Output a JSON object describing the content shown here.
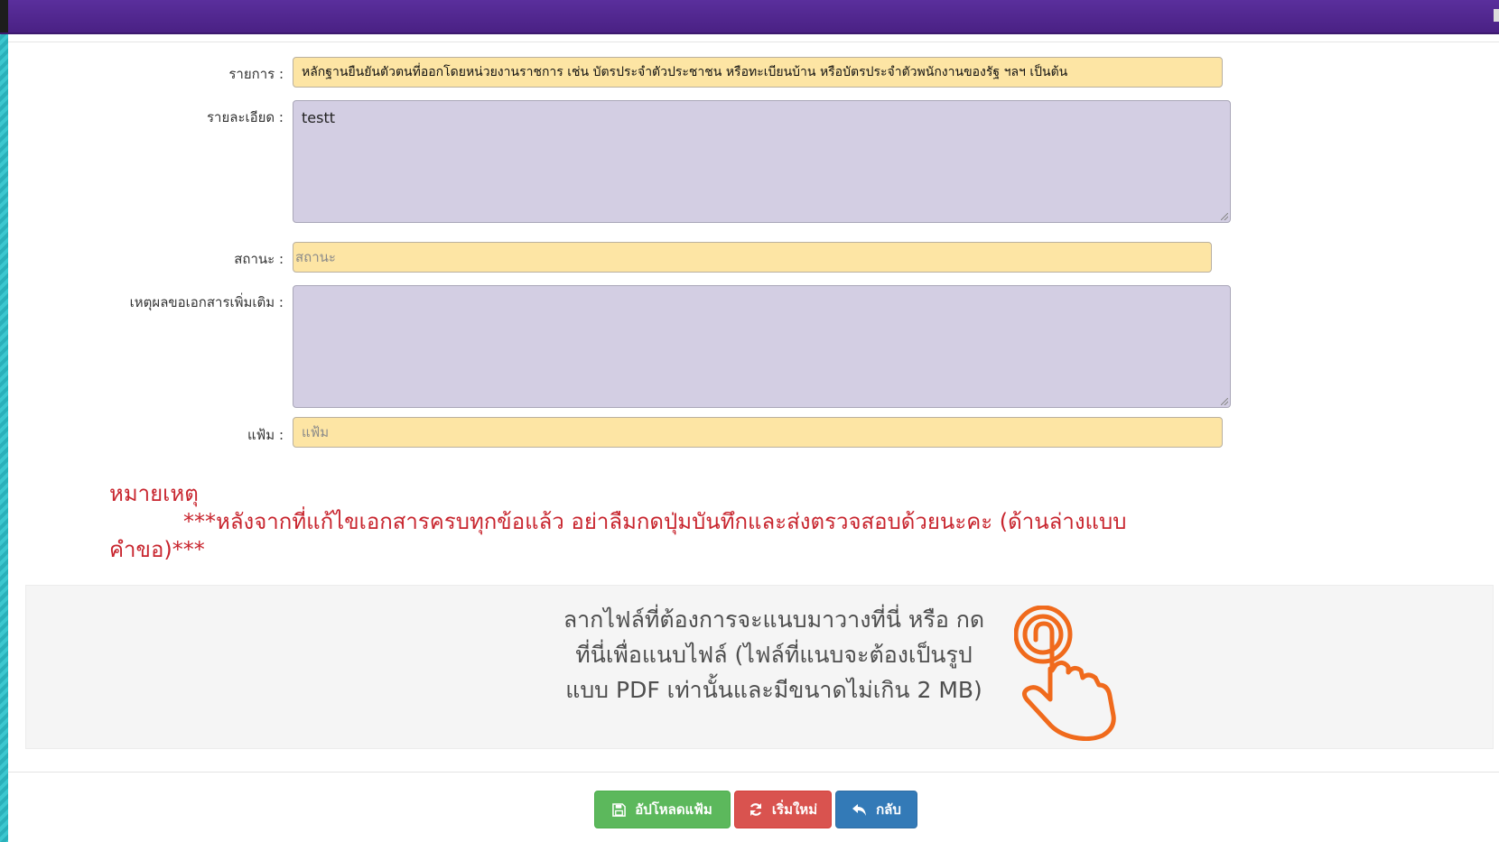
{
  "form": {
    "item_label": "รายการ :",
    "item_value": "หลักฐานยืนยันตัวตนที่ออกโดยหน่วยงานราชการ เช่น บัตรประจำตัวประชาชน หรือทะเบียนบ้าน หรือบัตรประจำตัวพนักงานของรัฐ ฯลฯ เป็นต้น",
    "detail_label": "รายละเอียด :",
    "detail_value": "testt",
    "status_label": "สถานะ :",
    "status_placeholder": "สถานะ",
    "reason_label": "เหตุผลขอเอกสารเพิ่มเติม :",
    "reason_value": "",
    "file_label": "แฟ้ม :",
    "file_placeholder": "แฟ้ม"
  },
  "note": {
    "title": "หมายเหตุ",
    "line1": "***หลังจากที่แก้ไขเอกสารครบทุกข้อแล้ว อย่าลืมกดปุ่มบันทึกและส่งตรวจสอบด้วยนะคะ (ด้านล่างแบบ",
    "line2": "คำขอ)***",
    "color": "#c8252e"
  },
  "dropzone": {
    "line1": "ลากไฟล์ที่ต้องการจะแนบมาวางที่นี่ หรือ กด",
    "line2": "ที่นี่เพื่อแนบไฟล์ (ไฟล์ที่แนบจะต้องเป็นรูป",
    "line3": "แบบ PDF เท่านั้นและมีขนาดไม่เกิน 2 MB)",
    "icon": "hand-tap-icon",
    "icon_color": "#f06a1c"
  },
  "buttons": {
    "upload_label": "อัปโหลดแฟ้ม",
    "upload_icon": "save-icon",
    "reset_label": "เริ่มใหม่",
    "reset_icon": "refresh-icon",
    "back_label": "กลับ",
    "back_icon": "reply-icon"
  },
  "colors": {
    "header_bar": "#4a2184",
    "input_yellow": "#fde5a4",
    "textarea_purple": "#d3cee3",
    "upload_green": "#5cb85c",
    "reset_red": "#d9534f",
    "back_blue": "#337ab7"
  }
}
